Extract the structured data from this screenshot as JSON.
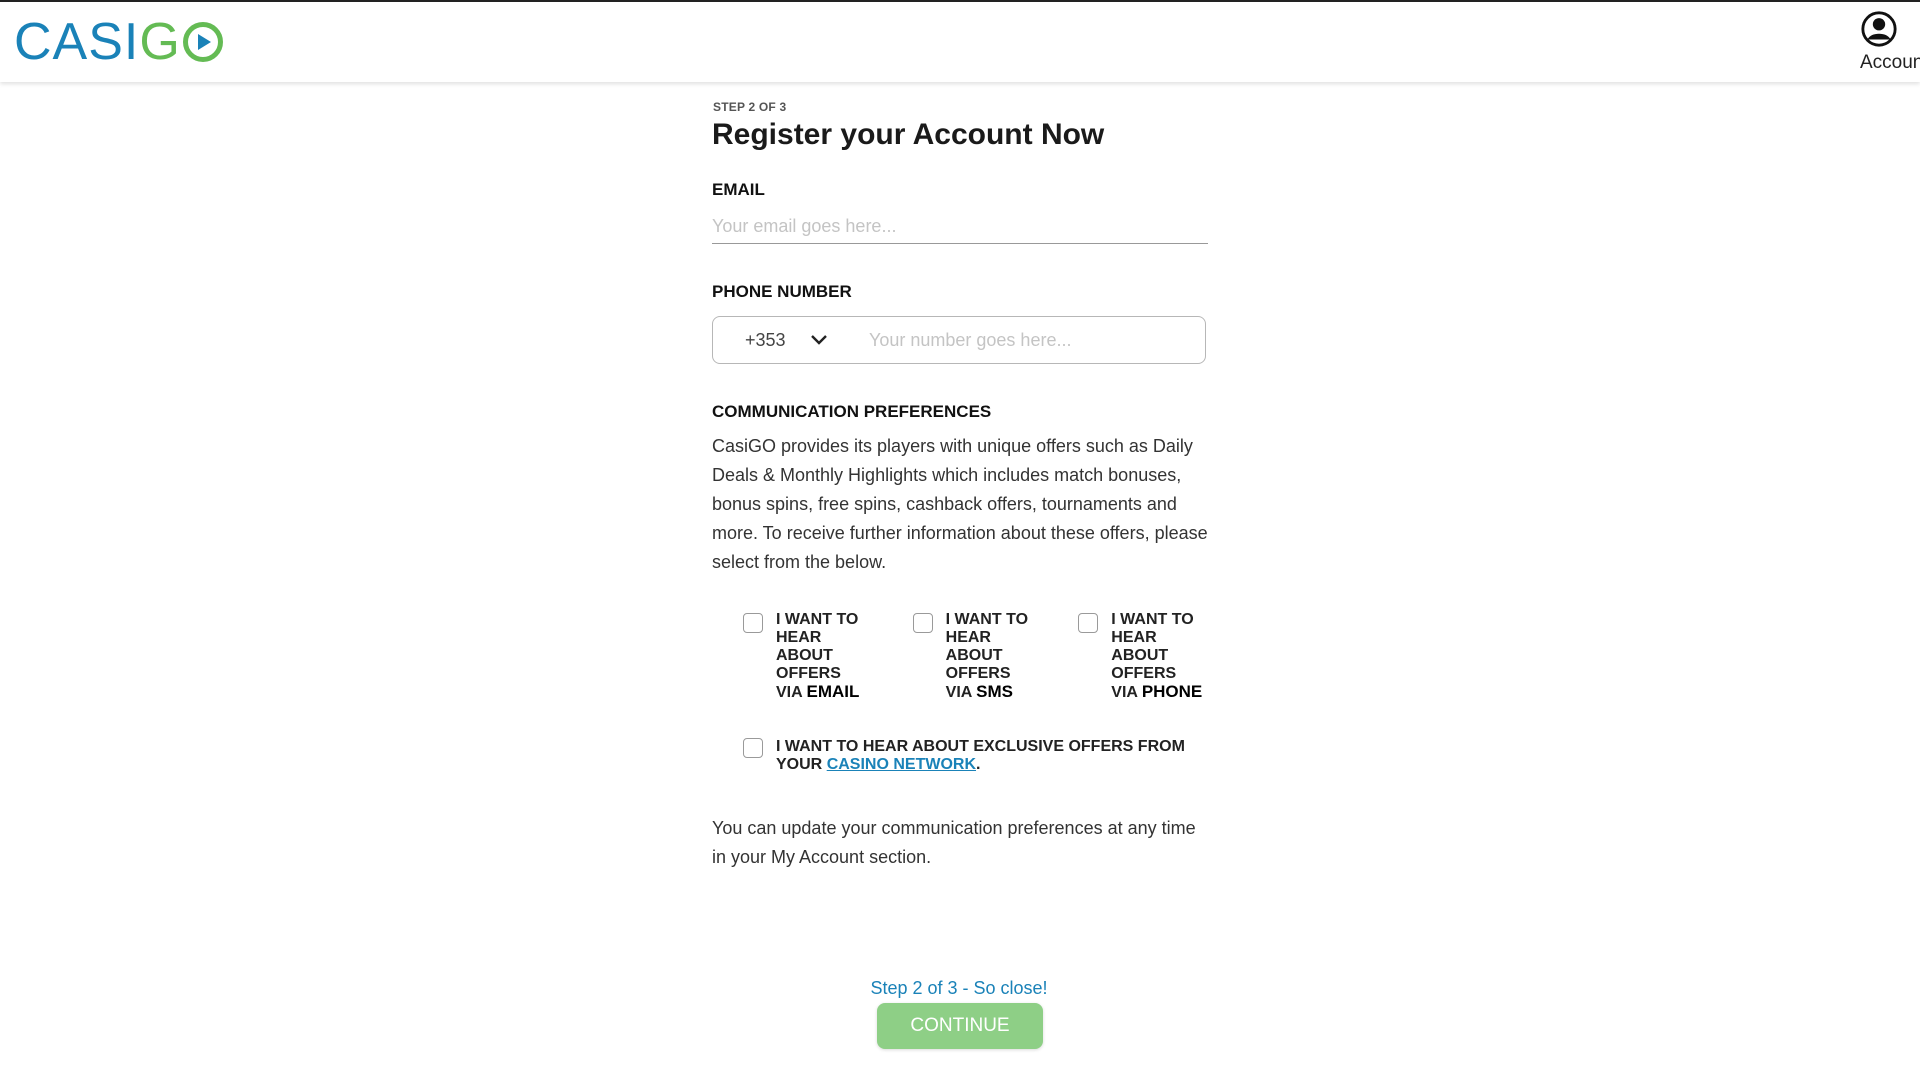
{
  "header": {
    "logo": {
      "left": "CASI",
      "g": "G"
    },
    "account_label": "Account"
  },
  "form": {
    "step_label": "STEP 2 OF 3",
    "title": "Register your Account Now",
    "email": {
      "label": "EMAIL",
      "value": "",
      "placeholder": "Your email goes here..."
    },
    "phone": {
      "label": "PHONE NUMBER",
      "country_code": "+353",
      "value": "",
      "placeholder": "Your number goes here..."
    },
    "communication": {
      "label": "COMMUNICATION PREFERENCES",
      "description": "CasiGO provides its players with unique offers such as Daily Deals & Monthly Highlights which includes match bonuses, bonus spins, free spins, cashback offers, tournaments and more. To receive further information about these offers, please select from the below.",
      "options": [
        {
          "prefix": "I WANT TO HEAR ABOUT OFFERS VIA",
          "channel": "EMAIL",
          "checked": false
        },
        {
          "prefix": "I WANT TO HEAR ABOUT OFFERS VIA",
          "channel": "SMS",
          "checked": false
        },
        {
          "prefix": "I WANT TO HEAR ABOUT OFFERS VIA",
          "channel": "PHONE",
          "checked": false
        }
      ],
      "network_option": {
        "prefix": "I WANT TO HEAR ABOUT EXCLUSIVE OFFERS FROM YOUR",
        "link": "CASINO NETWORK",
        "suffix": ".",
        "checked": false
      },
      "footer_note": "You can update your communication preferences at any time in your My Account section."
    },
    "progress_text": "Step 2 of 3 - So close!",
    "continue_label": "CONTINUE"
  },
  "colors": {
    "brand_blue": "#1a82b8",
    "brand_green": "#64bb54",
    "button_disabled_green": "#8ecf86"
  }
}
